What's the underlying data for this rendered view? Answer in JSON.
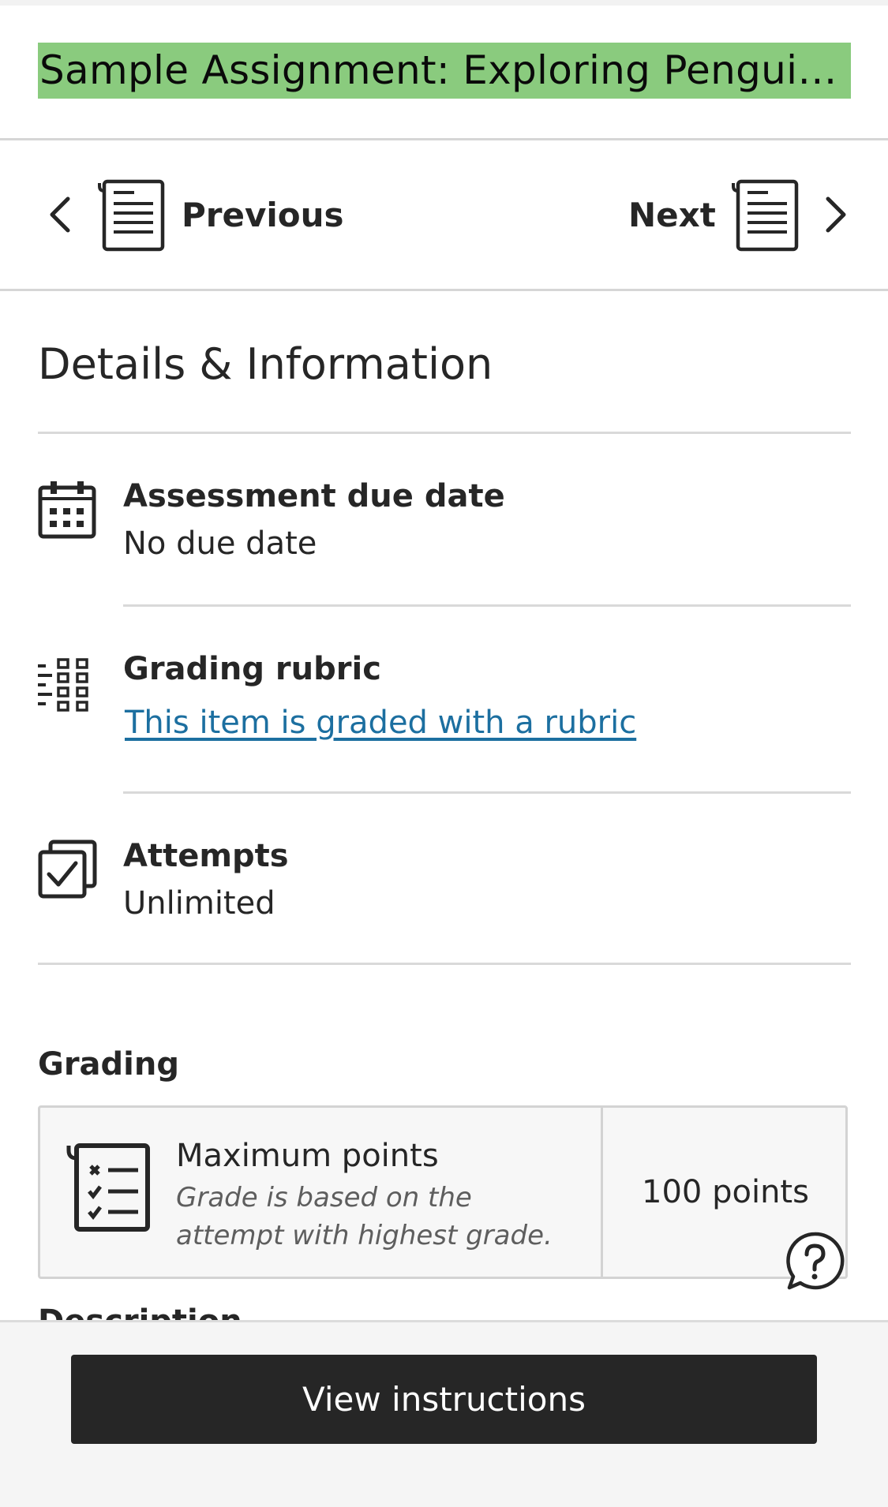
{
  "header": {
    "title": "Sample Assignment: Exploring Penguins in Their Natural Habitat"
  },
  "nav": {
    "previous_label": "Previous",
    "next_label": "Next"
  },
  "details": {
    "section_title": "Details & Information",
    "items": [
      {
        "label": "Assessment due date",
        "value": "No due date",
        "icon": "calendar-icon"
      },
      {
        "label": "Grading rubric",
        "link": "This item is graded with a rubric",
        "icon": "rubric-icon"
      },
      {
        "label": "Attempts",
        "value": "Unlimited",
        "icon": "attempts-icon"
      }
    ]
  },
  "grading": {
    "title": "Grading",
    "max_points_label": "Maximum points",
    "note": "Grade is based on the attempt with highest grade.",
    "points": "100 points"
  },
  "next_section_partial": "Description",
  "footer": {
    "button_label": "View instructions"
  },
  "colors": {
    "title_highlight": "#8acb7e",
    "link": "#1c6fa0",
    "button_bg": "#262626"
  }
}
